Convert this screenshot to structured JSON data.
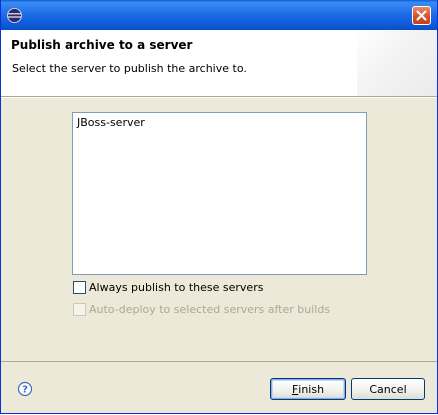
{
  "window": {
    "title": ""
  },
  "header": {
    "title": "Publish archive to a server",
    "subtitle": "Select the server to publish the archive to."
  },
  "servers": [
    "JBoss-server"
  ],
  "options": {
    "always_publish": {
      "label": "Always publish to these servers",
      "checked": false,
      "enabled": true
    },
    "auto_deploy": {
      "label": "Auto-deploy to selected servers after builds",
      "checked": false,
      "enabled": false
    }
  },
  "buttons": {
    "finish_mnemonic": "F",
    "finish_rest": "inish",
    "cancel": "Cancel"
  },
  "icons": {
    "app": "eclipse-icon",
    "close": "close-icon",
    "help": "help-icon"
  },
  "colors": {
    "titlebar": "#0b55d3",
    "close_button": "#d6532e",
    "dialog_bg": "#ece9d8",
    "header_bg": "#ffffff",
    "list_border": "#7f9db9"
  }
}
